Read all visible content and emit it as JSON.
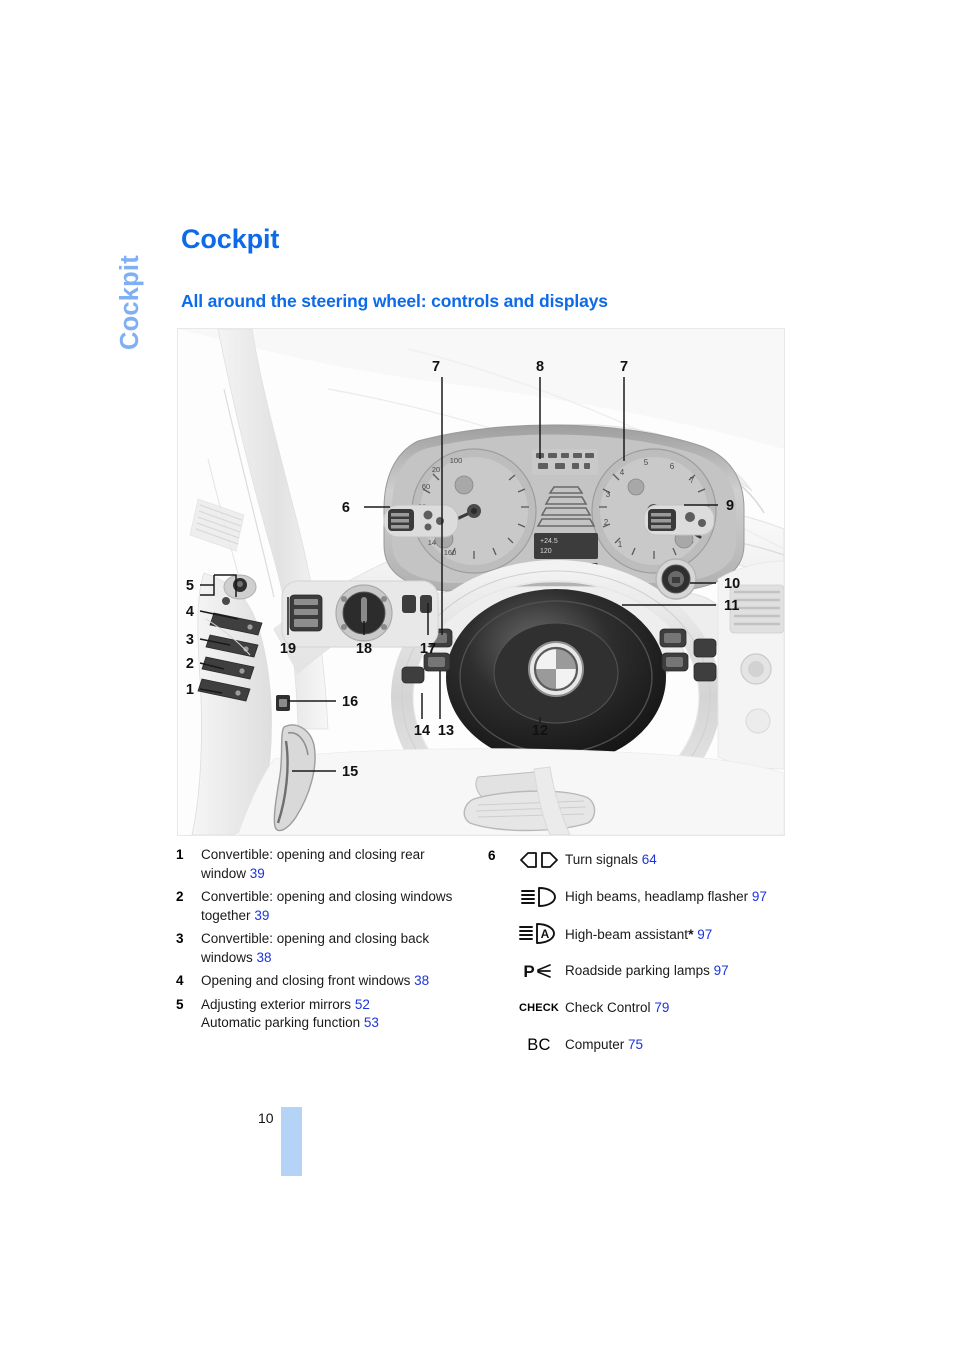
{
  "chapter_tab": "Cockpit",
  "heading": "Cockpit",
  "subheading": "All around the steering wheel: controls and displays",
  "colors": {
    "heading_blue": "#0d6ae8",
    "tab_blue": "#7fb0f5",
    "page_ref_blue": "#1c34dd",
    "page_bar_blue": "#b5d2f7"
  },
  "illustration": {
    "alt": "BMW cockpit: steering wheel, instrument cluster, door panel switches and pedals with numbered callouts",
    "callouts": [
      "1",
      "2",
      "3",
      "4",
      "5",
      "6",
      "7",
      "8",
      "7",
      "9",
      "10",
      "11",
      "12",
      "13",
      "14",
      "15",
      "16",
      "17",
      "18",
      "19"
    ],
    "watermark": ""
  },
  "legend_left": [
    {
      "num": "1",
      "lines": [
        {
          "text": "Convertible: opening and closing rear",
          "page": ""
        },
        {
          "text": "window",
          "page": "39"
        }
      ]
    },
    {
      "num": "2",
      "lines": [
        {
          "text": "Convertible: opening and closing windows",
          "page": ""
        },
        {
          "text": "together",
          "page": "39"
        }
      ]
    },
    {
      "num": "3",
      "lines": [
        {
          "text": "Convertible: opening and closing back",
          "page": ""
        },
        {
          "text": "windows",
          "page": "38"
        }
      ]
    },
    {
      "num": "4",
      "lines": [
        {
          "text": "Opening and closing front windows",
          "page": "38"
        }
      ]
    },
    {
      "num": "5",
      "lines": [
        {
          "text": "Adjusting exterior mirrors",
          "page": "52"
        },
        {
          "text": "Automatic parking function",
          "page": "53"
        }
      ]
    }
  ],
  "legend_right": {
    "num": "6",
    "items": [
      {
        "icon": "turn-signals-icon",
        "icon_kind": "svg",
        "label": "Turn signals",
        "page": "64",
        "star": ""
      },
      {
        "icon": "high-beams-icon",
        "icon_kind": "svg",
        "label": "High beams, headlamp flasher",
        "page": "97",
        "star": ""
      },
      {
        "icon": "high-beam-assistant-icon",
        "icon_kind": "svg",
        "label": "High-beam assistant",
        "page": "97",
        "star": "*"
      },
      {
        "icon": "roadside-parking-lamps-icon",
        "icon_kind": "svg",
        "label": "Roadside parking lamps",
        "page": "97",
        "star": ""
      },
      {
        "icon": "check-control-icon",
        "icon_kind": "text",
        "glyph": "CHECK",
        "label": "Check Control",
        "page": "79",
        "star": ""
      },
      {
        "icon": "computer-bc-icon",
        "icon_kind": "bc",
        "glyph": "BC",
        "label": "Computer",
        "page": "75",
        "star": ""
      }
    ]
  },
  "footer": {
    "page_number": "10"
  }
}
